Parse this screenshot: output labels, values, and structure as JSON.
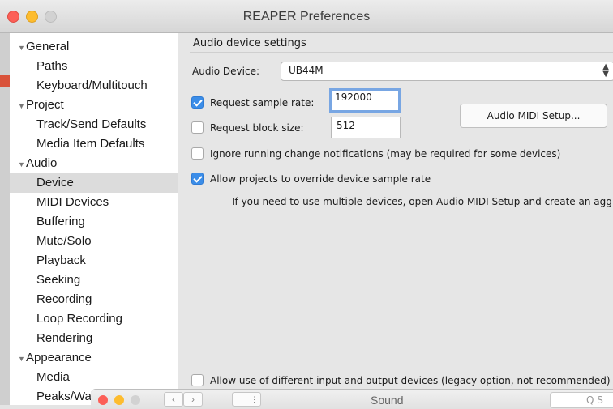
{
  "window": {
    "title": "REAPER Preferences"
  },
  "sidebar": {
    "items": [
      {
        "label": "General"
      },
      {
        "label": "Paths"
      },
      {
        "label": "Keyboard/Multitouch"
      },
      {
        "label": "Project"
      },
      {
        "label": "Track/Send Defaults"
      },
      {
        "label": "Media Item Defaults"
      },
      {
        "label": "Audio"
      },
      {
        "label": "Device"
      },
      {
        "label": "MIDI Devices"
      },
      {
        "label": "Buffering"
      },
      {
        "label": "Mute/Solo"
      },
      {
        "label": "Playback"
      },
      {
        "label": "Seeking"
      },
      {
        "label": "Recording"
      },
      {
        "label": "Loop Recording"
      },
      {
        "label": "Rendering"
      },
      {
        "label": "Appearance"
      },
      {
        "label": "Media"
      },
      {
        "label": "Peaks/Wa"
      }
    ],
    "selected": "Device"
  },
  "content": {
    "section_title": "Audio device settings",
    "audio_device_label": "Audio Device:",
    "audio_device_value": "UB44M",
    "request_sample_rate": {
      "label": "Request sample rate:",
      "value": "192000",
      "checked": true
    },
    "request_block_size": {
      "label": "Request block size:",
      "value": "512",
      "checked": false
    },
    "audio_midi_setup_button": "Audio MIDI Setup...",
    "ignore_notifications": {
      "label": "Ignore running change notifications (may be required for some devices)",
      "checked": false
    },
    "allow_override": {
      "label": "Allow projects to override device sample rate",
      "checked": true
    },
    "multi_device_hint": "If you need to use multiple devices, open Audio MIDI Setup and create an agg",
    "allow_different_io": {
      "label": "Allow use of different input and output devices (legacy option, not recommended)",
      "checked": false
    }
  },
  "sound_window": {
    "title": "Sound",
    "search_placeholder": "Q S"
  }
}
